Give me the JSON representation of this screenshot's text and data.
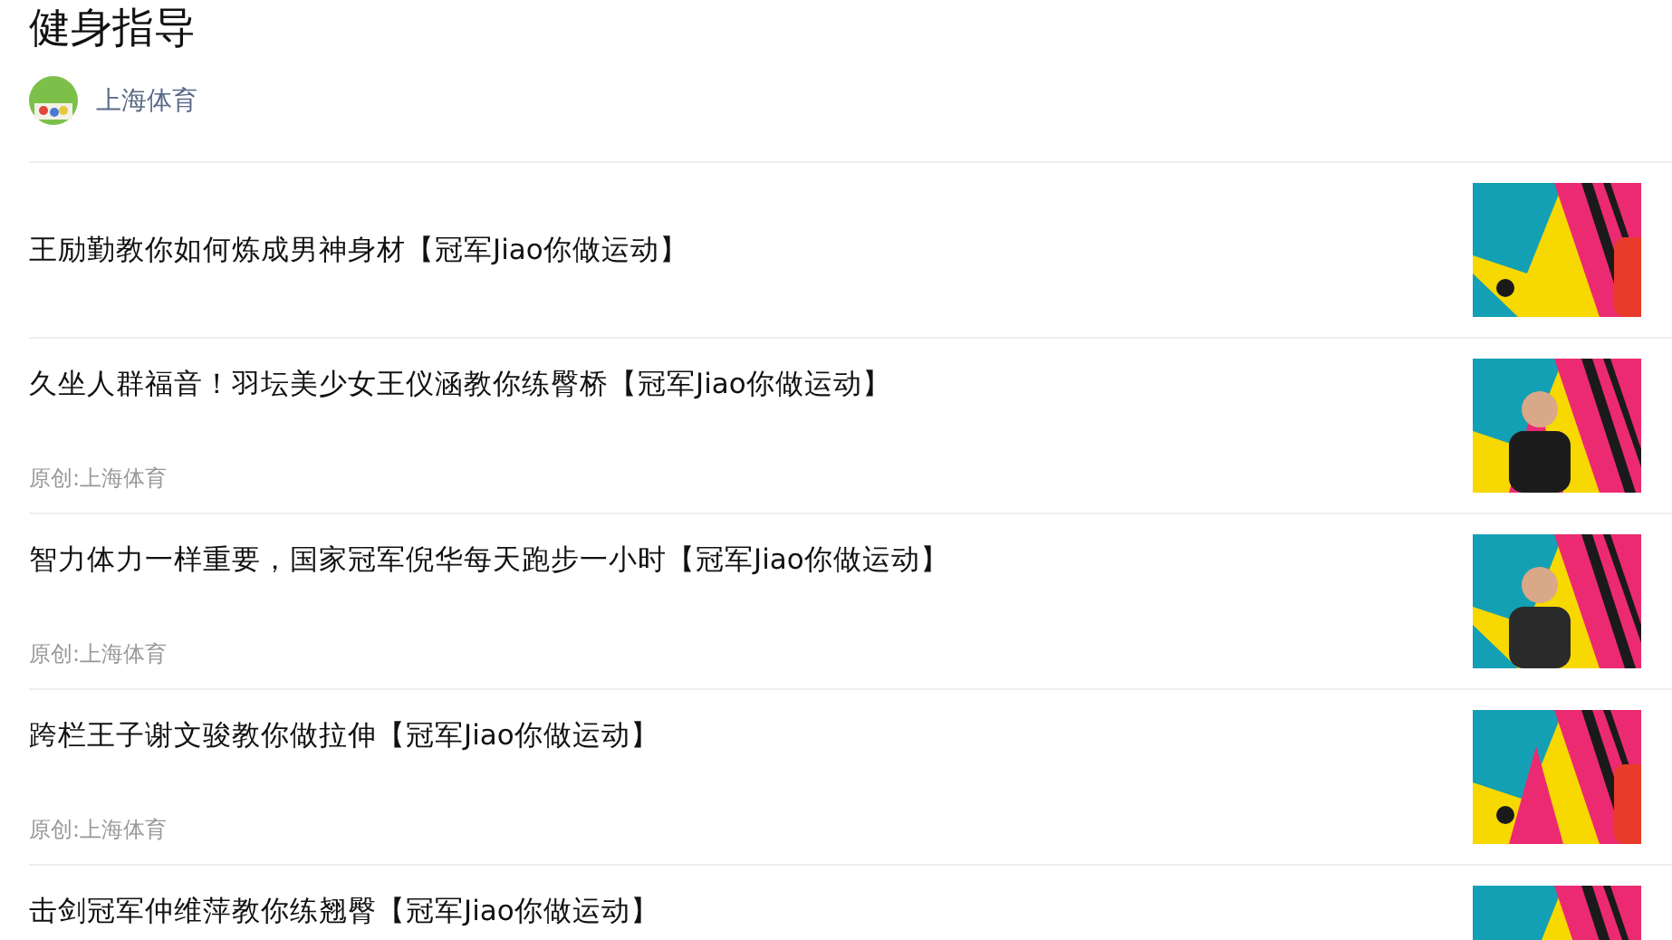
{
  "page_title": "健身指导",
  "author": {
    "name": "上海体育"
  },
  "articles": [
    {
      "title": "王励勤教你如何炼成男神身材【冠军Jiao你做运动】"
    },
    {
      "title": "久坐人群福音！羽坛美少女王仪涵教你练臀桥【冠军Jiao你做运动】",
      "source": "原创:上海体育"
    },
    {
      "title": "智力体力一样重要，国家冠军倪华每天跑步一小时【冠军Jiao你做运动】",
      "source": "原创:上海体育"
    },
    {
      "title": "跨栏王子谢文骏教你做拉伸【冠军Jiao你做运动】",
      "source": "原创:上海体育"
    },
    {
      "title": "击剑冠军仲维萍教你练翘臀【冠军Jiao你做运动】"
    }
  ]
}
